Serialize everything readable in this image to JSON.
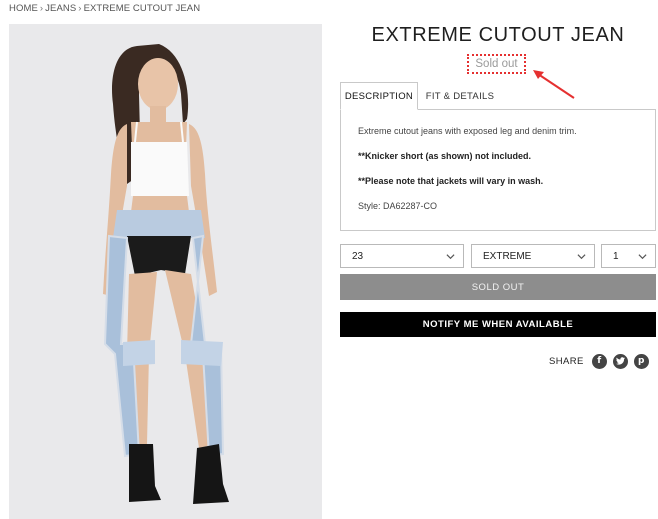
{
  "breadcrumb": {
    "items": [
      "HOME",
      "JEANS",
      "EXTREME CUTOUT JEAN"
    ],
    "separator": "›"
  },
  "product": {
    "title": "EXTREME CUTOUT JEAN",
    "status": "Sold out",
    "image_icon": "product-photo"
  },
  "tabs": {
    "description": "DESCRIPTION",
    "fit_details": "FIT & DETAILS"
  },
  "description": {
    "line1": "Extreme cutout jeans with exposed leg and denim trim.",
    "line2": "**Knicker short (as shown) not included.",
    "line3": "**Please note that jackets will vary in wash.",
    "line4": "Style: DA62287-CO"
  },
  "selectors": {
    "size": "23",
    "style": "EXTREME",
    "quantity": "1"
  },
  "buttons": {
    "sold_out": "SOLD OUT",
    "notify": "NOTIFY ME WHEN AVAILABLE"
  },
  "share": {
    "label": "SHARE",
    "icons": [
      "facebook-icon",
      "twitter-icon",
      "pinterest-icon"
    ]
  },
  "colors": {
    "annotation": "#e53030",
    "sold_out_bg": "#8d8d8d",
    "notify_bg": "#000000",
    "social_icon_bg": "#444444"
  }
}
